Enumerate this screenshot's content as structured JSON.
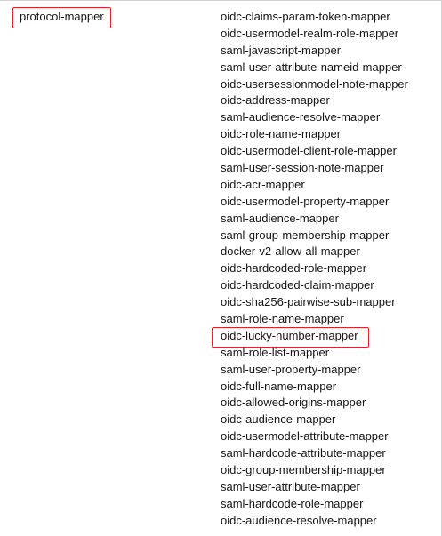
{
  "property_row": {
    "key": "protocol-mapper",
    "values": [
      "oidc-claims-param-token-mapper",
      "oidc-usermodel-realm-role-mapper",
      "saml-javascript-mapper",
      "saml-user-attribute-nameid-mapper",
      "oidc-usersessionmodel-note-mapper",
      "oidc-address-mapper",
      "saml-audience-resolve-mapper",
      "oidc-role-name-mapper",
      "oidc-usermodel-client-role-mapper",
      "saml-user-session-note-mapper",
      "oidc-acr-mapper",
      "oidc-usermodel-property-mapper",
      "saml-audience-mapper",
      "saml-group-membership-mapper",
      "docker-v2-allow-all-mapper",
      "oidc-hardcoded-role-mapper",
      "oidc-hardcoded-claim-mapper",
      "oidc-sha256-pairwise-sub-mapper",
      "saml-role-name-mapper",
      "oidc-lucky-number-mapper",
      "saml-role-list-mapper",
      "saml-user-property-mapper",
      "oidc-full-name-mapper",
      "oidc-allowed-origins-mapper",
      "oidc-audience-mapper",
      "oidc-usermodel-attribute-mapper",
      "saml-hardcode-attribute-mapper",
      "oidc-group-membership-mapper",
      "saml-user-attribute-mapper",
      "saml-hardcode-role-mapper",
      "oidc-audience-resolve-mapper"
    ]
  },
  "highlight_color": "#e0202a"
}
